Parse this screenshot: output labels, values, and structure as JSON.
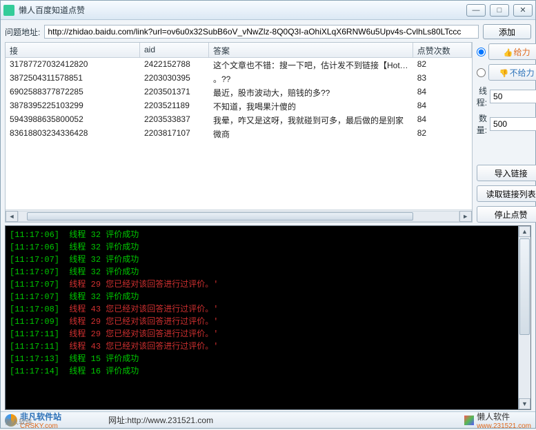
{
  "title": "懒人百度知道点赞",
  "winbtns": {
    "min": "—",
    "max": "□",
    "close": "✕"
  },
  "url": {
    "label": "问题地址:",
    "value": "http://zhidao.baidu.com/link?url=ov6u0x32SubB6oV_vNwZlz-8Q0Q3I-aOhiXLqX6RNW6u5Upv4s-CvlhLs80LTccc"
  },
  "addLabel": "添加",
  "columns": [
    "接",
    "aid",
    "答案",
    "点赞次数"
  ],
  "rows": [
    {
      "c0": "3178772703241​2820",
      "c1": "2422152788",
      "c2": "这个文章也不错：搜一下吧，估计发不到链接【Hot…",
      "c3": "82"
    },
    {
      "c0": "3872504311578​851",
      "c1": "2203030395",
      "c2": "。??",
      "c3": "83"
    },
    {
      "c0": "6902588377872​285",
      "c1": "2203501371",
      "c2": "最近，股市波动大，赔钱的多??",
      "c3": "84"
    },
    {
      "c0": "3878395225103​299",
      "c1": "2203521189",
      "c2": "不知道，我喝果汁傻的",
      "c3": "84"
    },
    {
      "c0": "5943988635800​052",
      "c1": "2203533837",
      "c2": "我晕，咋又是这呀，我就碰到可多，最后做的是别家",
      "c3": "84"
    },
    {
      "c0": "8361880323433​6428",
      "c1": "2203817107",
      "c2": "微商",
      "c3": "82"
    }
  ],
  "vote": {
    "up": "给力",
    "down": "不给力"
  },
  "thread": {
    "label": "线程:",
    "value": "50"
  },
  "count": {
    "label": "数量:",
    "value": "500"
  },
  "sideBtns": {
    "import": "导入链接",
    "read": "读取链接列表",
    "stop": "停止点赞"
  },
  "log": [
    {
      "t": "[11:17:06]",
      "th": "线程 32",
      "msg": "评价成功",
      "cls": "lg"
    },
    {
      "t": "[11:17:06]",
      "th": "线程 32",
      "msg": "评价成功",
      "cls": "lg"
    },
    {
      "t": "[11:17:07]",
      "th": "线程 32",
      "msg": "评价成功",
      "cls": "lg"
    },
    {
      "t": "[11:17:07]",
      "th": "线程 32",
      "msg": "评价成功",
      "cls": "lg"
    },
    {
      "t": "[11:17:07]",
      "th": "线程 29",
      "msg": "您已经对该回答进行过评价。'",
      "cls": "lr"
    },
    {
      "t": "[11:17:07]",
      "th": "线程 32",
      "msg": "评价成功",
      "cls": "lg"
    },
    {
      "t": "[11:17:08]",
      "th": "线程 43",
      "msg": "您已经对该回答进行过评价。'",
      "cls": "lr"
    },
    {
      "t": "[11:17:09]",
      "th": "线程 29",
      "msg": "您已经对该回答进行过评价。'",
      "cls": "lr"
    },
    {
      "t": "[11:17:11]",
      "th": "线程 29",
      "msg": "您已经对该回答进行过评价。'",
      "cls": "lr"
    },
    {
      "t": "[11:17:11]",
      "th": "线程 43",
      "msg": "您已经对该回答进行过评价。'",
      "cls": "lr"
    },
    {
      "t": "[11:17:13]",
      "th": "线程 15",
      "msg": "评价成功",
      "cls": "lg"
    },
    {
      "t": "[11:17:14]",
      "th": "线程 16",
      "msg": "评价成功",
      "cls": "lg"
    }
  ],
  "status": {
    "leftName": "非凡软件站",
    "leftDomain": "CRSKY.com",
    "leftSmall": "懒人软件",
    "mid": "网址:http://www.231521.com",
    "rightName": "懒人软件",
    "rightDomain": "www.231521.com"
  }
}
